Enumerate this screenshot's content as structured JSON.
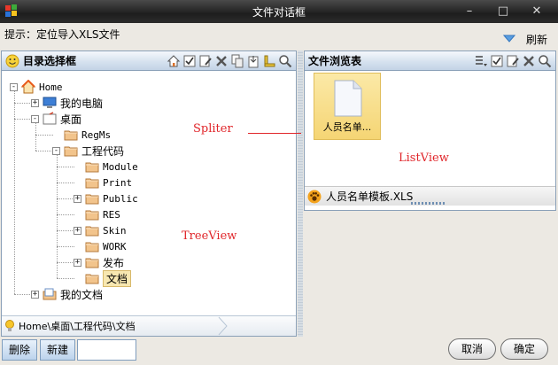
{
  "window": {
    "title": "文件对话框"
  },
  "hint": {
    "text": "提示：定位导入XLS文件"
  },
  "refresh": {
    "label": "刷新"
  },
  "left_panel": {
    "title": "目录选择框",
    "tree": [
      {
        "label": "Home",
        "level": 0,
        "expander": "-",
        "icon": "home-icon",
        "mono": true
      },
      {
        "label": "我的电脑",
        "level": 1,
        "expander": "+",
        "icon": "computer-icon",
        "mono": false
      },
      {
        "label": "桌面",
        "level": 1,
        "expander": "-",
        "icon": "desktop-icon",
        "mono": false
      },
      {
        "label": "RegMs",
        "level": 2,
        "expander": "",
        "icon": "folder-icon",
        "mono": true
      },
      {
        "label": "工程代码",
        "level": 2,
        "expander": "-",
        "icon": "folder-icon",
        "mono": false
      },
      {
        "label": "Module",
        "level": 3,
        "expander": "",
        "icon": "folder-icon",
        "mono": true
      },
      {
        "label": "Print",
        "level": 3,
        "expander": "",
        "icon": "folder-icon",
        "mono": true
      },
      {
        "label": "Public",
        "level": 3,
        "expander": "+",
        "icon": "folder-icon",
        "mono": true
      },
      {
        "label": "RES",
        "level": 3,
        "expander": "",
        "icon": "folder-icon",
        "mono": true
      },
      {
        "label": "Skin",
        "level": 3,
        "expander": "+",
        "icon": "folder-icon",
        "mono": true
      },
      {
        "label": "WORK",
        "level": 3,
        "expander": "",
        "icon": "folder-icon",
        "mono": true
      },
      {
        "label": "发布",
        "level": 3,
        "expander": "+",
        "icon": "folder-icon",
        "mono": false
      },
      {
        "label": "文档",
        "level": 3,
        "expander": "",
        "icon": "folder-icon",
        "mono": false,
        "selected": true
      },
      {
        "label": "我的文档",
        "level": 1,
        "expander": "+",
        "icon": "documents-icon",
        "mono": false
      }
    ],
    "path": "Home\\桌面\\工程代码\\文档"
  },
  "right_panel": {
    "title": "文件浏览表",
    "item_label": "人员名单...",
    "status_file": "人员名单模板.XLS"
  },
  "annotations": {
    "spliter": "Spliter",
    "listview": "ListView",
    "treeview": "TreeView"
  },
  "buttons": {
    "delete": "删除",
    "new": "新建",
    "cancel": "取消",
    "ok": "确定"
  },
  "colors": {
    "accent": "#c3d3e6",
    "selection": "#f7e7b0",
    "annotation": "#e0252a"
  }
}
